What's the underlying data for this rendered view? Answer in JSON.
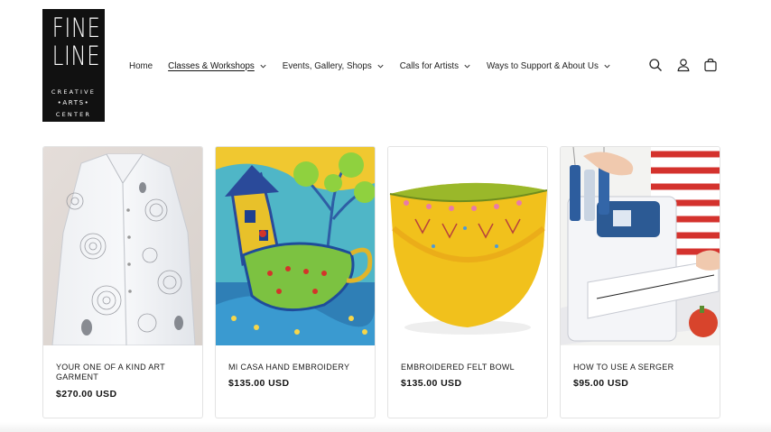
{
  "logo": {
    "line1": "FINE",
    "line2": "LINE",
    "line3": "CREATIVE",
    "line4": "•ARTS•",
    "line5": "CENTER"
  },
  "nav": {
    "items": [
      {
        "label": "Home",
        "dropdown": false,
        "active": false
      },
      {
        "label": "Classes & Workshops",
        "dropdown": true,
        "active": true
      },
      {
        "label": "Events, Gallery, Shops",
        "dropdown": true,
        "active": false
      },
      {
        "label": "Calls for Artists",
        "dropdown": true,
        "active": false
      },
      {
        "label": "Ways to Support & About Us",
        "dropdown": true,
        "active": false
      }
    ]
  },
  "header_icons": [
    "search-icon",
    "account-icon",
    "cart-icon"
  ],
  "products": [
    {
      "title": "YOUR ONE OF A KIND ART GARMENT",
      "price": "$270.00 USD",
      "image": "white-art-garment"
    },
    {
      "title": "MI CASA HAND EMBROIDERY",
      "price": "$135.00 USD",
      "image": "house-teacup-embroidery"
    },
    {
      "title": "EMBROIDERED FELT BOWL",
      "price": "$135.00 USD",
      "image": "yellow-felt-bowl"
    },
    {
      "title": "HOW TO USE A SERGER",
      "price": "$95.00 USD",
      "image": "serger-machine"
    }
  ]
}
